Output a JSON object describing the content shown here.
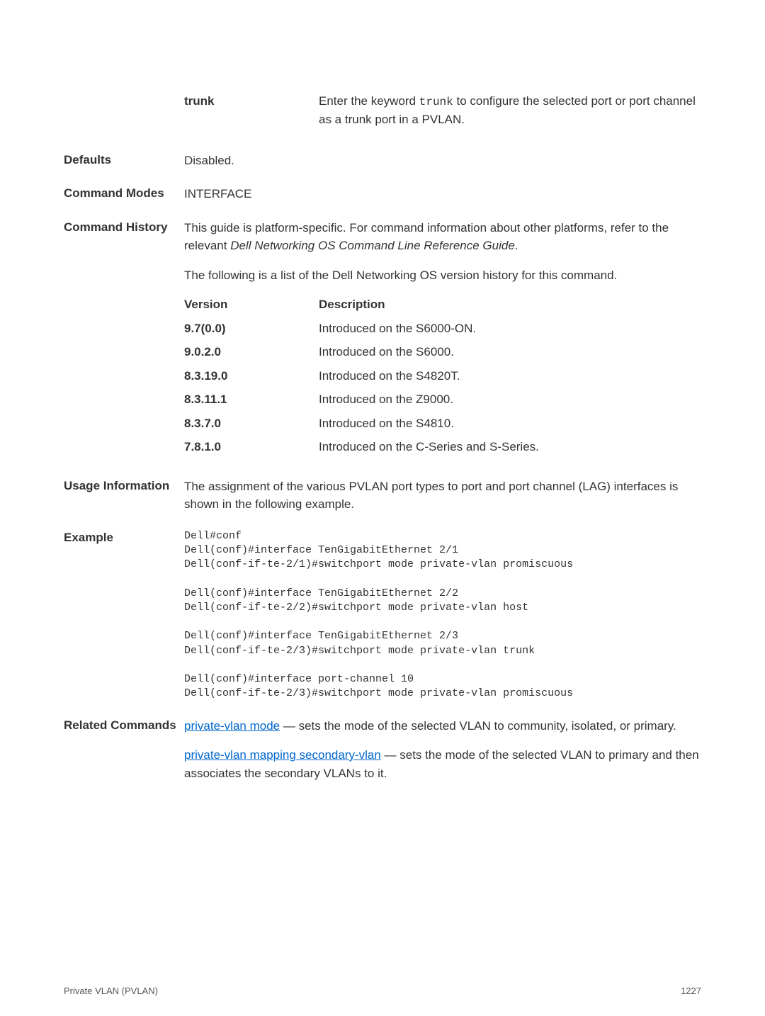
{
  "r_trunk": {
    "label": "trunk",
    "text1": "Enter the keyword ",
    "code": "trunk",
    "text2": " to configure the selected port or port channel as a trunk port in a PVLAN."
  },
  "defaults": {
    "label": "Defaults",
    "value": "Disabled."
  },
  "modes": {
    "label": "Command Modes",
    "value": "INTERFACE"
  },
  "history": {
    "label": "Command History",
    "p1a": "This guide is platform-specific. For command information about other platforms, refer to the relevant ",
    "p1i": "Dell Networking OS Command Line Reference Guide",
    "p1b": ".",
    "p2": "The following is a list of the Dell Networking OS version history for this command.",
    "h1": "Version",
    "h2": "Description",
    "rows": [
      {
        "v": "9.7(0.0)",
        "d": "Introduced on the S6000-ON."
      },
      {
        "v": "9.0.2.0",
        "d": "Introduced on the S6000."
      },
      {
        "v": "8.3.19.0",
        "d": "Introduced on the S4820T."
      },
      {
        "v": "8.3.11.1",
        "d": "Introduced on the Z9000."
      },
      {
        "v": "8.3.7.0",
        "d": "Introduced on the S4810."
      },
      {
        "v": "7.8.1.0",
        "d": "Introduced on the C-Series and S-Series."
      }
    ]
  },
  "usage": {
    "label": "Usage Information",
    "text": "The assignment of the various PVLAN port types to port and port channel (LAG) interfaces is shown in the following example."
  },
  "example": {
    "label": "Example",
    "code": "Dell#conf\nDell(conf)#interface TenGigabitEthernet 2/1\nDell(conf-if-te-2/1)#switchport mode private-vlan promiscuous\n\nDell(conf)#interface TenGigabitEthernet 2/2\nDell(conf-if-te-2/2)#switchport mode private-vlan host\n\nDell(conf)#interface TenGigabitEthernet 2/3\nDell(conf-if-te-2/3)#switchport mode private-vlan trunk\n\nDell(conf)#interface port-channel 10\nDell(conf-if-te-2/3)#switchport mode private-vlan promiscuous"
  },
  "related": {
    "label": "Related Commands",
    "l1": "private-vlan mode",
    "t1": " — sets the mode of the selected VLAN to community, isolated, or primary.",
    "l2": "private-vlan mapping secondary-vlan",
    "t2": " — sets the mode of the selected VLAN to primary and then associates the secondary VLANs to it."
  },
  "footer": {
    "left": "Private VLAN (PVLAN)",
    "right": "1227"
  }
}
